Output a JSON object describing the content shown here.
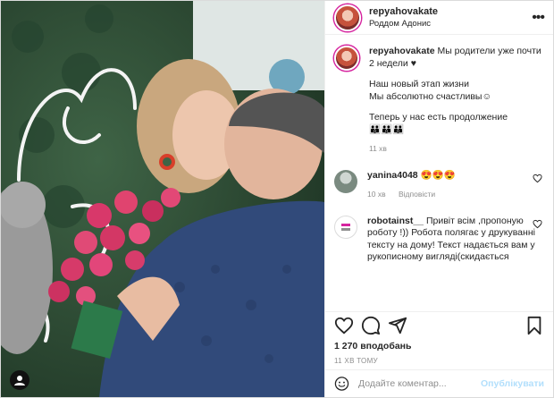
{
  "header": {
    "username": "repyahovakate",
    "location": "Роддом Адонис",
    "more_label": "•••"
  },
  "caption": {
    "username": "repyahovakate",
    "line1": "Мы родители уже почти 2 недели ♥",
    "line2": "Наш новый этап жизни",
    "line3": "Мы абсолютно счастливы☺",
    "line4": "Теперь у нас есть продолжение",
    "line5": "👪👪👪",
    "age": "11 хв"
  },
  "comments": [
    {
      "username": "yanina4048",
      "text": "😍😍😍",
      "age": "10 хв",
      "reply_label": "Відповісти"
    },
    {
      "username": "robotainst__",
      "text": "Привіт всім ,пропоную роботу !)) Робота полягає у друкуванні тексту на дому! Текст надається вам у рукописному вигляді(скидається"
    }
  ],
  "likes": "1 270 вподобань",
  "timestamp": "11 ХВ ТОМУ",
  "add_comment": {
    "placeholder": "Додайте коментар...",
    "post_label": "Опублікувати"
  },
  "icons": {
    "like": "heart-outline-icon",
    "comment": "comment-bubble-icon",
    "share": "paper-plane-icon",
    "save": "bookmark-icon",
    "emoji": "smiley-icon",
    "comment_like": "small-heart-icon"
  },
  "colors": {
    "accent_link": "#b2dffc",
    "muted_text": "#8e8e8e",
    "border": "#dbdbdb"
  }
}
